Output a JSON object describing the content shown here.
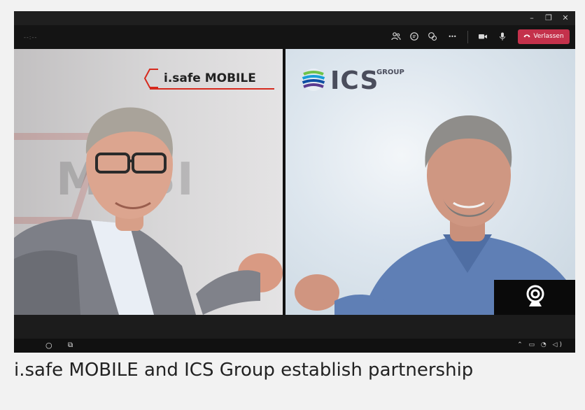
{
  "window": {
    "minimize_glyph": "–",
    "restore_glyph": "❐",
    "close_glyph": "✕"
  },
  "toolbar": {
    "meeting_timer": "--:--",
    "participants_icon": "people-icon",
    "chat_icon": "chat-icon",
    "reactions_icon": "reactions-icon",
    "more_glyph": "•••",
    "camera_icon": "video-camera-icon",
    "mic_icon": "microphone-icon",
    "leave_label": "Verlassen",
    "leave_color": "#c4314b"
  },
  "video": {
    "left_participant": {
      "logo_text": "i.safe MOBILE",
      "background_word": "MOBI"
    },
    "right_participant": {
      "logo_text": "ICS",
      "logo_suffix": "GROUP"
    },
    "self_view_icon": "webcam-icon"
  },
  "taskbar": {
    "start_glyph": "○",
    "taskview_glyph": "⧉",
    "tray_text": "⌃ ▭ ◔ ◁)"
  },
  "caption": "i.safe MOBILE and ICS Group establish partnership",
  "colors": {
    "accent_red": "#c4314b",
    "isafe_red": "#d62a1e",
    "ics_gray": "#4a4d5c"
  }
}
